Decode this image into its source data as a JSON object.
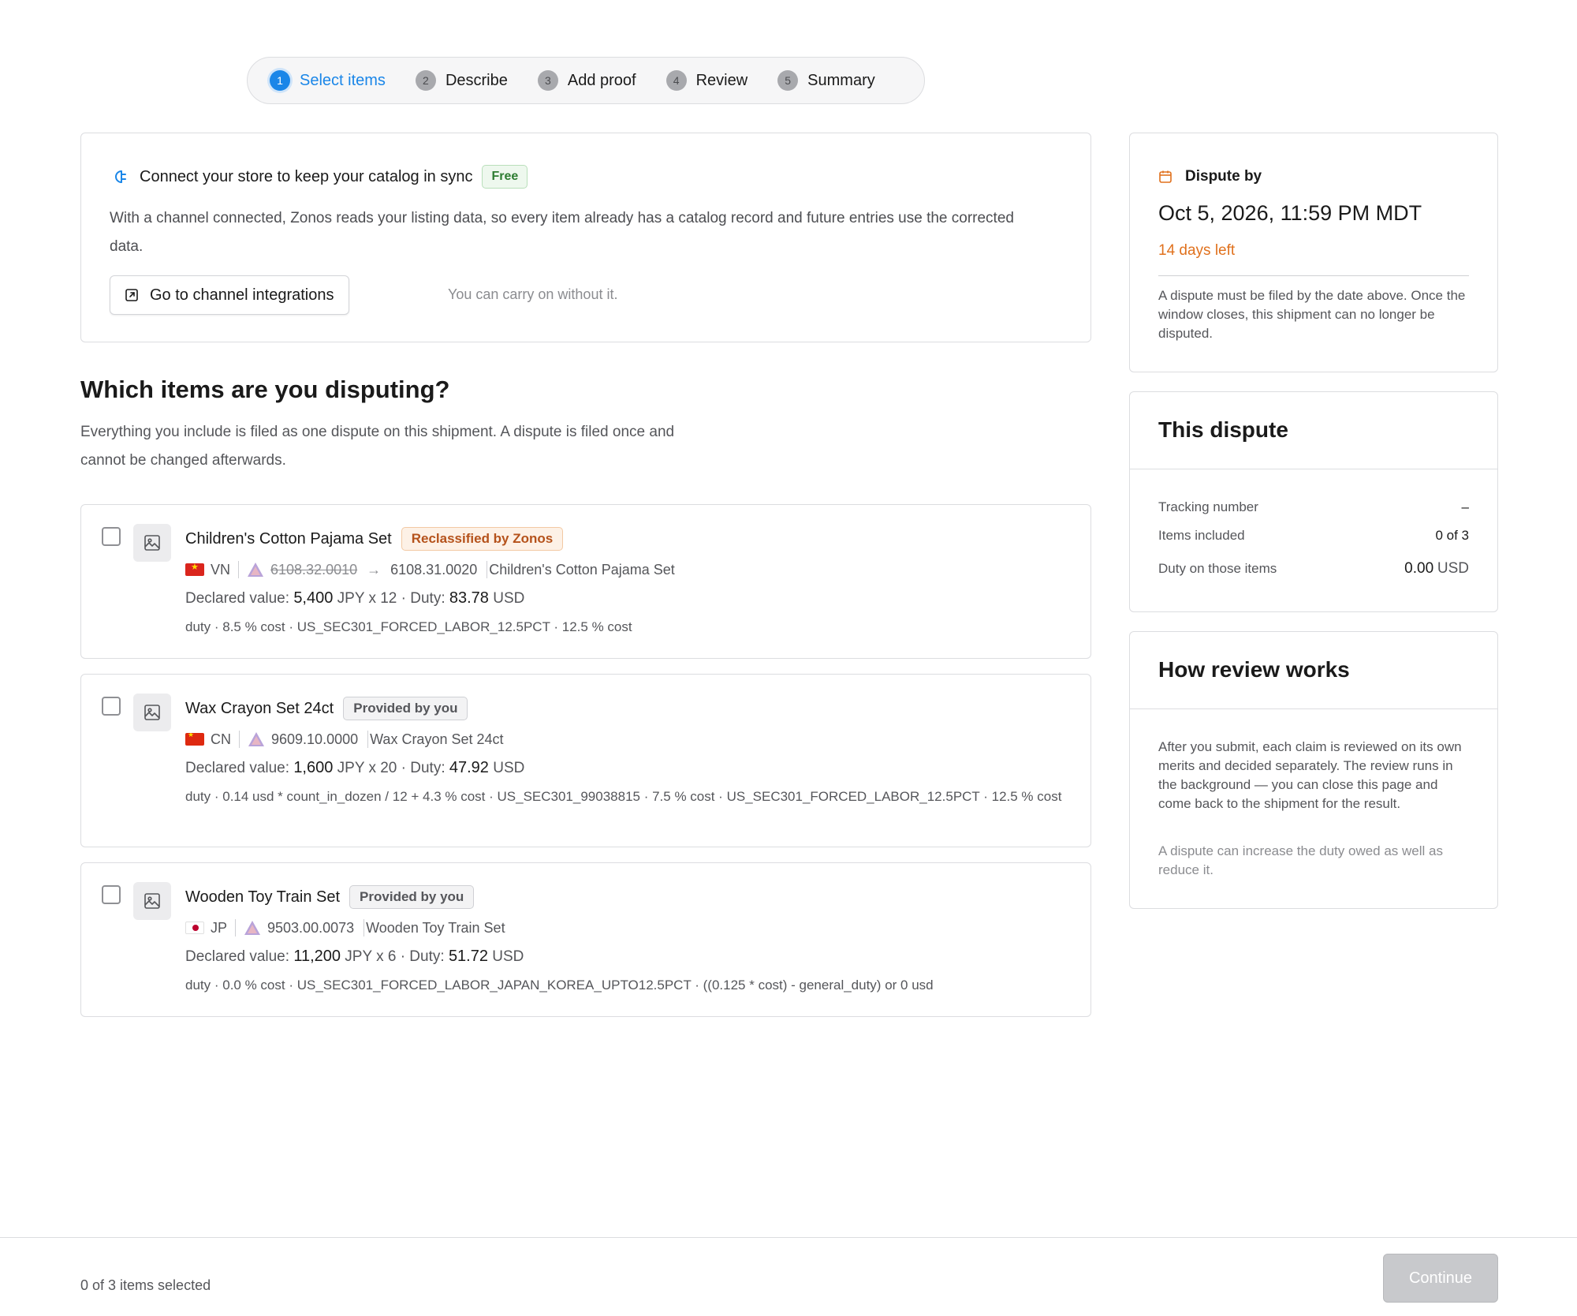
{
  "stepper": {
    "steps": [
      {
        "num": "1",
        "label": "Select items"
      },
      {
        "num": "2",
        "label": "Describe"
      },
      {
        "num": "3",
        "label": "Add proof"
      },
      {
        "num": "4",
        "label": "Review"
      },
      {
        "num": "5",
        "label": "Summary"
      }
    ],
    "active_index": 0
  },
  "connect": {
    "title": "Connect your store to keep your catalog in sync",
    "badge": "Free",
    "text": "With a channel connected, Zonos reads your listing data, so every item already has a catalog record and future entries use the corrected data.",
    "button_label": "Go to channel integrations",
    "hint": "You can carry on without it."
  },
  "items_section": {
    "title": "Which items are you disputing?",
    "subtitle": "Everything you include is filed as one dispute on this shipment. A dispute is filed once and cannot be changed afterwards."
  },
  "items": [
    {
      "title": "Children's Cotton Pajama Set",
      "tag": "Reclassified by Zonos",
      "country": "VN",
      "hs_old": "6108.32.0010",
      "hs_arrow": "→",
      "hs_code": "6108.31.0020",
      "hs_desc": "Children's Cotton Pajama Set",
      "declared_label": "Declared value:",
      "declared_amount": "5,400",
      "declared_unit": "JPY x 12",
      "duty_label": "· Duty:",
      "duty_amount": "83.78",
      "duty_unit": "USD",
      "duty_formula": "duty · 8.5 % cost · US_SEC301_FORCED_LABOR_12.5PCT · 12.5 % cost"
    },
    {
      "title": "Wax Crayon Set 24ct",
      "tag": "Provided by you",
      "country": "CN",
      "hs_code": "9609.10.0000",
      "hs_desc": "Wax Crayon Set 24ct",
      "declared_label": "Declared value:",
      "declared_amount": "1,600",
      "declared_unit": "JPY x 20",
      "duty_label": "· Duty:",
      "duty_amount": "47.92",
      "duty_unit": "USD",
      "duty_formula": "duty · 0.14 usd * count_in_dozen / 12 + 4.3 % cost · US_SEC301_99038815 · 7.5 % cost · US_SEC301_FORCED_LABOR_12.5PCT · 12.5 % cost"
    },
    {
      "title": "Wooden Toy Train Set",
      "tag": "Provided by you",
      "country": "JP",
      "hs_code": "9503.00.0073",
      "hs_desc": "Wooden Toy Train Set",
      "declared_label": "Declared value:",
      "declared_amount": "11,200",
      "declared_unit": "JPY x 6",
      "duty_label": "· Duty:",
      "duty_amount": "51.72",
      "duty_unit": "USD",
      "duty_formula": "duty · 0.0 % cost · US_SEC301_FORCED_LABOR_JAPAN_KOREA_UPTO12.5PCT · ((0.125 * cost) - general_duty) or 0 usd"
    }
  ],
  "dispute_by": {
    "label": "Dispute by",
    "date": "Oct 5, 2026, 11:59 PM MDT",
    "days_left": "14 days left",
    "note": "A dispute must be filed by the date above. Once the window closes, this shipment can no longer be disputed."
  },
  "this_dispute": {
    "title": "This dispute",
    "tracking_label": "Tracking number",
    "tracking_value": "–",
    "items_label": "Items included",
    "items_value": "0 of 3",
    "duty_label": "Duty on those items",
    "duty_amount": "0.00",
    "duty_unit": "USD"
  },
  "how_review": {
    "title": "How review works",
    "text": "After you submit, each claim is reviewed on its own merits and decided separately. The review runs in the background — you can close this page and come back to the shipment for the result.",
    "note": "A dispute can increase the duty owed as well as reduce it."
  },
  "footer": {
    "selected_text": "0 of 3 items selected",
    "continue_label": "Continue"
  },
  "colors": {
    "accent": "#1a86e8",
    "warning": "#e0711d",
    "success": "#2e7d32"
  }
}
